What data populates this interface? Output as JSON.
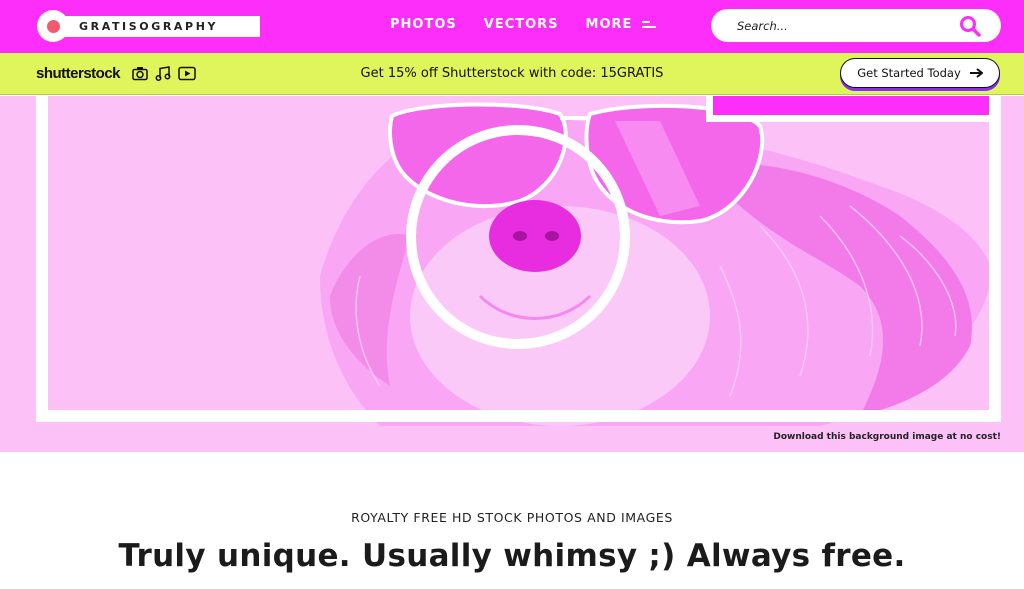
{
  "header": {
    "logo_text": "GRATISOGRAPHY",
    "nav": [
      {
        "label": "PHOTOS"
      },
      {
        "label": "VECTORS"
      },
      {
        "label": "MORE"
      }
    ],
    "search": {
      "placeholder": "Search...",
      "value": ""
    },
    "colors": {
      "background": "#fd2dfa",
      "logo_dot": "#f25a6d"
    }
  },
  "promo": {
    "brand": "shutterstock",
    "icons": [
      "camera-icon",
      "music-note-icon",
      "video-play-icon"
    ],
    "message": "Get 15% off Shutterstock with code: 15GRATIS",
    "cta_label": "Get Started Today",
    "cta_icon": "arrow-right-icon",
    "colors": {
      "background": "#dff55b",
      "cta_shadow": "#8b2df0"
    }
  },
  "hero": {
    "image_subject": "dog wearing sunglasses",
    "caption": "Download this background image at no cost!",
    "colors": {
      "tint": "#fcc2f7",
      "accent": "#fd2dfa"
    }
  },
  "intro": {
    "kicker": "ROYALTY FREE HD STOCK PHOTOS AND IMAGES",
    "headline": "Truly unique. Usually whimsy ;) Always free."
  }
}
